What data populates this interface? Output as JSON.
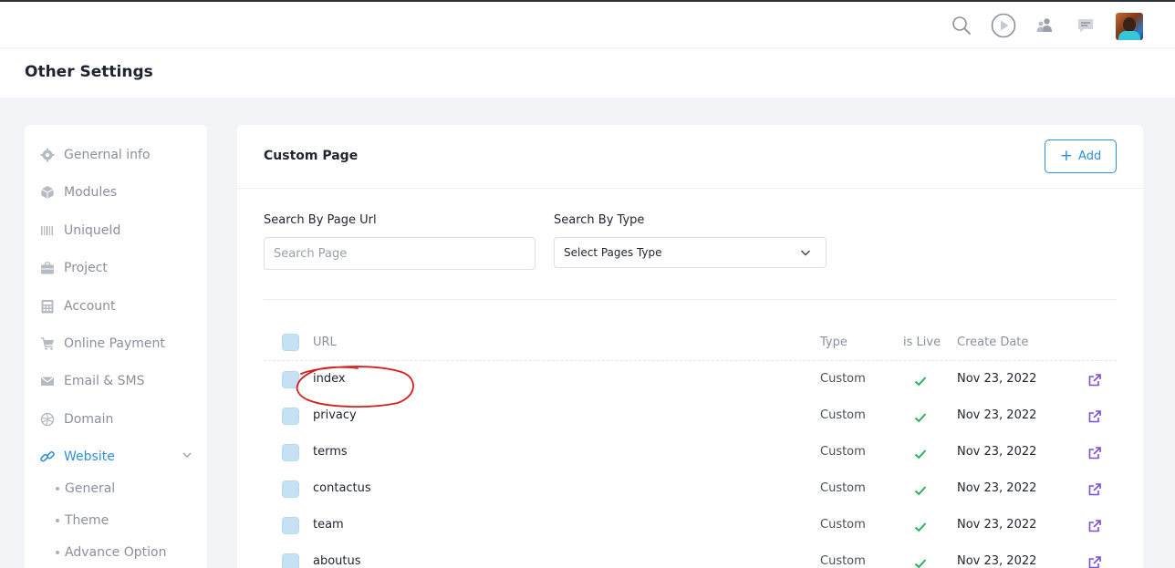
{
  "header": {
    "title": "Other Settings"
  },
  "topbar": {
    "icons": [
      "search-icon",
      "play-icon",
      "users-icon",
      "chat-icon"
    ],
    "avatar": "user-avatar"
  },
  "sidebar": {
    "items": [
      {
        "label": "Genernal info",
        "icon": "gear-icon"
      },
      {
        "label": "Modules",
        "icon": "cube-icon"
      },
      {
        "label": "UniqueId",
        "icon": "barcode-icon"
      },
      {
        "label": "Project",
        "icon": "briefcase-icon"
      },
      {
        "label": "Account",
        "icon": "calculator-icon"
      },
      {
        "label": "Online Payment",
        "icon": "cart-icon"
      },
      {
        "label": "Email & SMS",
        "icon": "envelope-icon"
      },
      {
        "label": "Domain",
        "icon": "globe-icon"
      },
      {
        "label": "Website",
        "icon": "link-icon",
        "active": true
      }
    ],
    "subitems": [
      "General",
      "Theme",
      "Advance Option"
    ]
  },
  "card": {
    "title": "Custom Page",
    "add_label": "Add",
    "search_url_label": "Search By Page Url",
    "search_url_placeholder": "Search Page",
    "search_type_label": "Search By Type",
    "search_type_value": "Select Pages Type"
  },
  "table": {
    "columns": {
      "url": "URL",
      "type": "Type",
      "live": "is Live",
      "date": "Create Date"
    },
    "rows": [
      {
        "url": "index",
        "type": "Custom",
        "live": true,
        "date": "Nov 23, 2022"
      },
      {
        "url": "privacy",
        "type": "Custom",
        "live": true,
        "date": "Nov 23, 2022"
      },
      {
        "url": "terms",
        "type": "Custom",
        "live": true,
        "date": "Nov 23, 2022"
      },
      {
        "url": "contactus",
        "type": "Custom",
        "live": true,
        "date": "Nov 23, 2022"
      },
      {
        "url": "team",
        "type": "Custom",
        "live": true,
        "date": "Nov 23, 2022"
      },
      {
        "url": "aboutus",
        "type": "Custom",
        "live": true,
        "date": "Nov 23, 2022"
      }
    ]
  },
  "colors": {
    "accent": "#2f8fd8",
    "check": "#27b061",
    "link_icon": "#7b4fd6",
    "annotation": "#d42020"
  }
}
